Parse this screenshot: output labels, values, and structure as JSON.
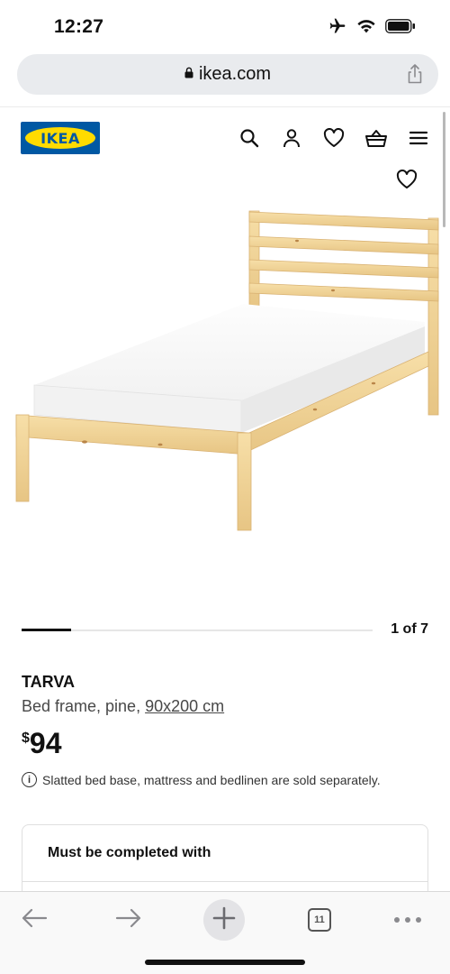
{
  "status_bar": {
    "time": "12:27",
    "icons": [
      "airplane-icon",
      "wifi-icon",
      "battery-icon"
    ]
  },
  "browser": {
    "url": "ikea.com",
    "toolbar": {
      "back_icon": "arrow-left-icon",
      "forward_icon": "arrow-right-icon",
      "new_tab_icon": "plus-icon",
      "tabs_count": "11",
      "more_icon": "ellipsis-icon"
    }
  },
  "site": {
    "logo_text": "IKEA",
    "logo_colors": {
      "blue": "#0058a3",
      "yellow": "#ffdb00"
    },
    "header_icons": [
      "search-icon",
      "user-icon",
      "heart-icon",
      "basket-icon",
      "menu-icon"
    ]
  },
  "product": {
    "name": "TARVA",
    "description": "Bed frame, pine, ",
    "size": "90x200 cm",
    "price_currency": "$",
    "price_value": "94",
    "notice": "Slatted bed base, mattress and bedlinen are sold separately.",
    "image_counter": "1 of 7",
    "image_progress": 0.14
  },
  "completion_card": {
    "title": "Must be completed with"
  }
}
